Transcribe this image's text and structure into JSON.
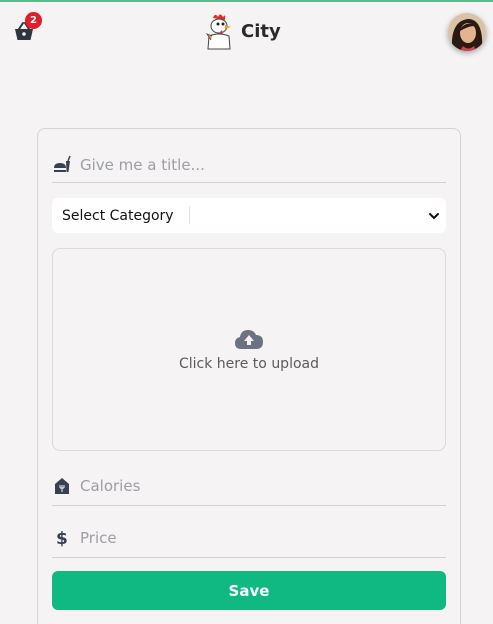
{
  "header": {
    "cart_count": "2",
    "brand_name": "City"
  },
  "form": {
    "title_placeholder": "Give me a title...",
    "category_selected": "Select Category",
    "upload_label": "Click here to upload",
    "calories_placeholder": "Calories",
    "price_placeholder": "Price",
    "save_label": "Save"
  },
  "colors": {
    "accent": "#10b981",
    "badge": "#e11d2a",
    "icon": "#374151"
  }
}
